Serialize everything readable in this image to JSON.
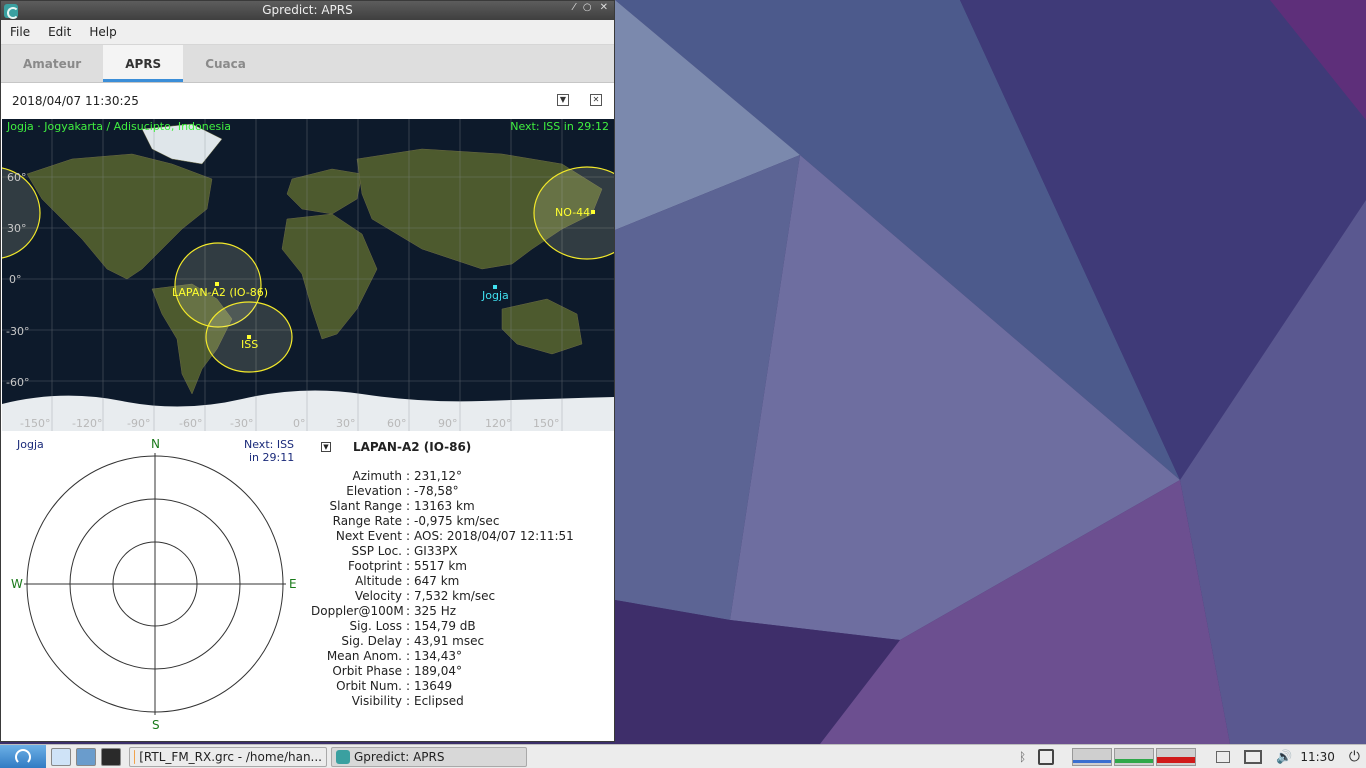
{
  "window": {
    "title": "Gpredict: APRS",
    "controls": [
      "⁄",
      "○",
      "✕"
    ]
  },
  "menu": [
    "File",
    "Edit",
    "Help"
  ],
  "tabs": [
    {
      "label": "Amateur",
      "active": false
    },
    {
      "label": "APRS",
      "active": true
    },
    {
      "label": "Cuaca",
      "active": false
    }
  ],
  "module": {
    "timestamp": "2018/04/07 11:30:25",
    "menu_icon": "chevron-down-icon",
    "close_icon": "close-icon"
  },
  "map": {
    "location": "Jogja · Jogyakarta / Adisucipto, Indonesia",
    "next_event": "Next: ISS in 29:12",
    "lat_labels": [
      "60°",
      "30°",
      "0°",
      "-30°",
      "-60°"
    ],
    "lon_labels": [
      "-150°",
      "-120°",
      "-90°",
      "-60°",
      "-30°",
      "0°",
      "30°",
      "60°",
      "90°",
      "120°",
      "150°"
    ],
    "satellites": [
      "LAPAN-A2 (IO-86)",
      "ISS",
      "NO-44"
    ],
    "ground_station": "Jogja",
    "colors": {
      "satellite": "#ffff30",
      "station": "#40e0f0",
      "header": "#40f040"
    }
  },
  "polar": {
    "station": "Jogja",
    "next_line1": "Next: ISS",
    "next_line2": "in 29:11",
    "N": "N",
    "S": "S",
    "E": "E",
    "W": "W"
  },
  "details": {
    "satellite": "LAPAN-A2 (IO-86)",
    "rows": [
      {
        "key": "Azimuth",
        "value": "231,12°"
      },
      {
        "key": "Elevation",
        "value": "-78,58°"
      },
      {
        "key": "Slant Range",
        "value": "13163 km"
      },
      {
        "key": "Range Rate",
        "value": "-0,975 km/sec"
      },
      {
        "key": "Next Event",
        "value": "AOS: 2018/04/07 12:11:51"
      },
      {
        "key": "SSP Loc.",
        "value": "GI33PX"
      },
      {
        "key": "Footprint",
        "value": "5517 km"
      },
      {
        "key": "Altitude",
        "value": "647 km"
      },
      {
        "key": "Velocity",
        "value": "7,532 km/sec"
      },
      {
        "key": "Doppler@100M",
        "value": "325 Hz"
      },
      {
        "key": "Sig. Loss",
        "value": "154,79 dB"
      },
      {
        "key": "Sig. Delay",
        "value": "43,91 msec"
      },
      {
        "key": "Mean Anom.",
        "value": "134,43°"
      },
      {
        "key": "Orbit Phase",
        "value": "189,04°"
      },
      {
        "key": "Orbit Num.",
        "value": "13649"
      },
      {
        "key": "Visibility",
        "value": "Eclipsed"
      }
    ]
  },
  "taskbar": {
    "tasks": [
      "[RTL_FM_RX.grc - /home/han...",
      "Gpredict: APRS"
    ],
    "clock": "11:30"
  }
}
